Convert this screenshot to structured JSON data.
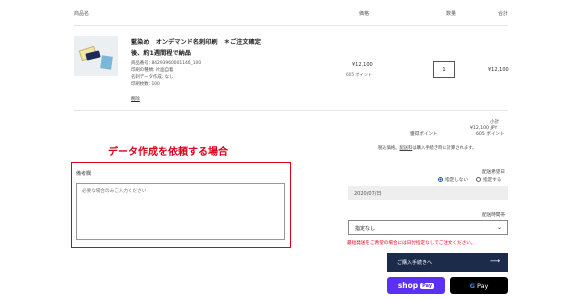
{
  "table_header": {
    "product": "商品名",
    "price": "価格",
    "quantity": "数量",
    "total": "合計"
  },
  "cart_item": {
    "name": "藍染め　オンデマンド名刺印刷　＊ご注文確定後、約1週間程で納品",
    "details": [
      "商品番号: 84293960001146_100",
      "印刷の種類: 片面自着",
      "名刺データ作成: なし",
      "印刷枚数: 100"
    ],
    "delete_label": "削除",
    "price": "¥12,100",
    "points": "605 ポイント",
    "quantity": "1",
    "line_total": "¥12,100"
  },
  "summary": {
    "subtotal_label": "小計",
    "subtotal_value": "¥12,100 JPY",
    "points_label": "獲得ポイント",
    "points_value": "605 ポイント",
    "tax_note_prefix": "税込価格。",
    "tax_note_link": "配送料",
    "tax_note_suffix": "は購入手続き時に計算されます。"
  },
  "notes_section": {
    "heading": "データ作成を依頼する場合",
    "label": "備考欄",
    "placeholder": "必要な場合のみご入力ください"
  },
  "delivery": {
    "date_label": "配送希望日",
    "option_unspecified": "指定しない",
    "option_specify": "指定する",
    "date_value": "2020/07/日",
    "time_label": "配送時間帯",
    "time_selected": "指定なし",
    "warning": "最短発送をご希望の場合には日付指定なしでご注文ください。"
  },
  "buttons": {
    "checkout": "ご購入手続きへ",
    "shop_pay": "shop",
    "shop_pay_pill": "Pay",
    "gpay_g": "G",
    "gpay_text": "Pay"
  }
}
